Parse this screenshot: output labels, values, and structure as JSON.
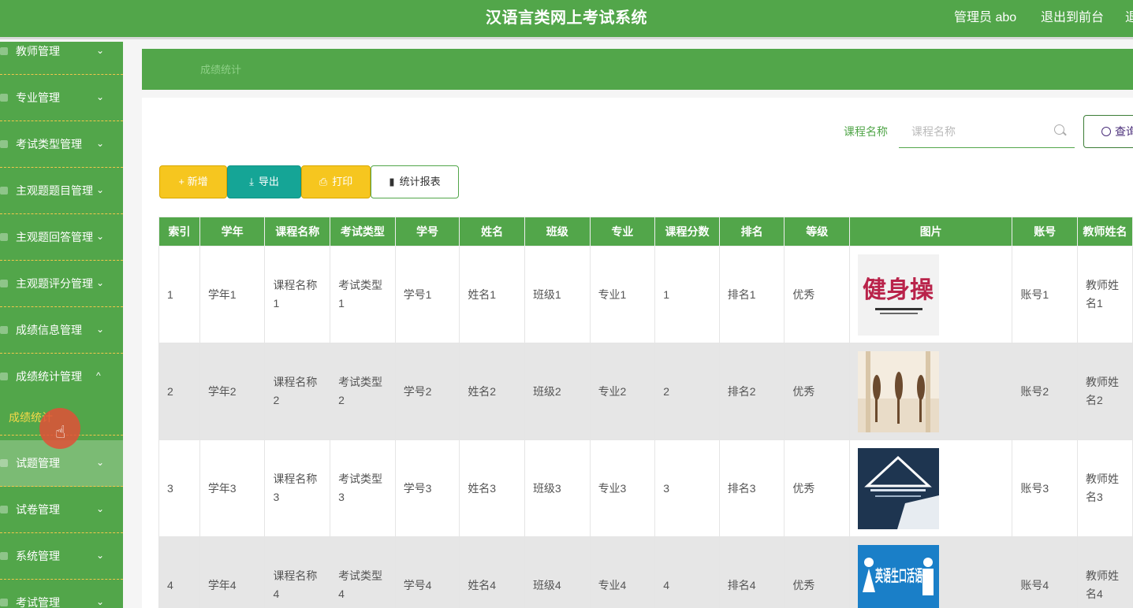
{
  "header": {
    "title": "汉语言类网上考试系统",
    "admin": "管理员 abo",
    "front": "退出到前台",
    "logout": "退"
  },
  "sidebar": {
    "items": [
      {
        "label": "教师管理",
        "chev": "⌄"
      },
      {
        "label": "专业管理",
        "chev": "⌄"
      },
      {
        "label": "考试类型管理",
        "chev": "⌄"
      },
      {
        "label": "主观题题目管理",
        "chev": "⌄"
      },
      {
        "label": "主观题回答管理",
        "chev": "⌄"
      },
      {
        "label": "主观题评分管理",
        "chev": "⌄"
      },
      {
        "label": "成绩信息管理",
        "chev": "⌄"
      },
      {
        "label": "成绩统计管理",
        "chev": "^"
      },
      {
        "label": "试题管理",
        "chev": "⌄"
      },
      {
        "label": "试卷管理",
        "chev": "⌄"
      },
      {
        "label": "系统管理",
        "chev": "⌄"
      },
      {
        "label": "考试管理",
        "chev": "⌄"
      }
    ],
    "subitem": "成绩统计"
  },
  "breadcrumb": "成绩统计",
  "search": {
    "label": "课程名称",
    "placeholder": "课程名称",
    "button": "查询"
  },
  "toolbar": {
    "add": "+ 新增",
    "export": "导出",
    "print": "打印",
    "report": "统计报表"
  },
  "table": {
    "headers": [
      "索引",
      "学年",
      "课程名称",
      "考试类型",
      "学号",
      "姓名",
      "班级",
      "专业",
      "课程分数",
      "排名",
      "等级",
      "图片",
      "账号",
      "教师姓名"
    ],
    "rows": [
      {
        "index": "1",
        "year": "学年1",
        "course": "课程名称1",
        "type": "考试类型1",
        "sid": "学号1",
        "name": "姓名1",
        "cls": "班级1",
        "major": "专业1",
        "score": "1",
        "rank": "排名1",
        "grade": "优秀",
        "account": "账号1",
        "teacher": "教师姓名1",
        "img_text": "健身操"
      },
      {
        "index": "2",
        "year": "学年2",
        "course": "课程名称2",
        "type": "考试类型2",
        "sid": "学号2",
        "name": "姓名2",
        "cls": "班级2",
        "major": "专业2",
        "score": "2",
        "rank": "排名2",
        "grade": "优秀",
        "account": "账号2",
        "teacher": "教师姓名2",
        "img_text": ""
      },
      {
        "index": "3",
        "year": "学年3",
        "course": "课程名称3",
        "type": "考试类型3",
        "sid": "学号3",
        "name": "姓名3",
        "cls": "班级3",
        "major": "专业3",
        "score": "3",
        "rank": "排名3",
        "grade": "优秀",
        "account": "账号3",
        "teacher": "教师姓名3",
        "img_text": ""
      },
      {
        "index": "4",
        "year": "学年4",
        "course": "课程名称4",
        "type": "考试类型4",
        "sid": "学号4",
        "name": "姓名4",
        "cls": "班级4",
        "major": "专业4",
        "score": "4",
        "rank": "排名4",
        "grade": "优秀",
        "account": "账号4",
        "teacher": "教师姓名4",
        "img_text": "英语生口活语"
      }
    ]
  },
  "colors": {
    "primary": "#52a64a",
    "accent_yellow": "#f6c61f",
    "teal": "#15a596",
    "dash": "#f3c64b"
  }
}
